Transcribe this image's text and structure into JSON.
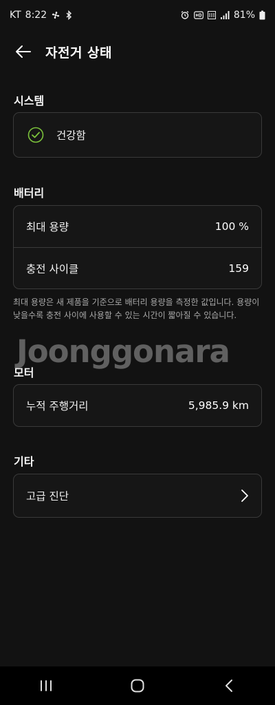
{
  "status_bar": {
    "carrier": "KT",
    "time": "8:22",
    "battery": "81%",
    "icons": [
      "fan-icon",
      "bluetooth-icon",
      "alarm-icon",
      "hd-voice-icon",
      "lte-icon",
      "signal-icon",
      "battery-icon"
    ]
  },
  "header": {
    "title": "자전거 상태",
    "back_icon": "arrow-left-icon"
  },
  "system": {
    "section_title": "시스템",
    "status_label": "건강함",
    "status_icon": "check-circle-icon",
    "accent_color": "#7CC33B"
  },
  "battery": {
    "section_title": "배터리",
    "rows": [
      {
        "label": "최대 용량",
        "value": "100 %"
      },
      {
        "label": "충전 사이클",
        "value": "159"
      }
    ],
    "note": "최대 용량은 새 제품을 기준으로 배터리 용량을 측정한 값입니다. 용량이 낮을수록 충전 사이에 사용할 수 있는 시간이 짧아질 수 있습니다."
  },
  "motor": {
    "section_title": "모터",
    "rows": [
      {
        "label": "누적 주행거리",
        "value": "5,985.9 km"
      }
    ]
  },
  "other": {
    "section_title": "기타",
    "rows": [
      {
        "label": "고급 진단",
        "icon": "chevron-right-icon"
      }
    ]
  },
  "watermark": "Joonggonara",
  "nav_bar": {
    "buttons": [
      "recent-apps-icon",
      "home-icon",
      "back-icon"
    ]
  }
}
